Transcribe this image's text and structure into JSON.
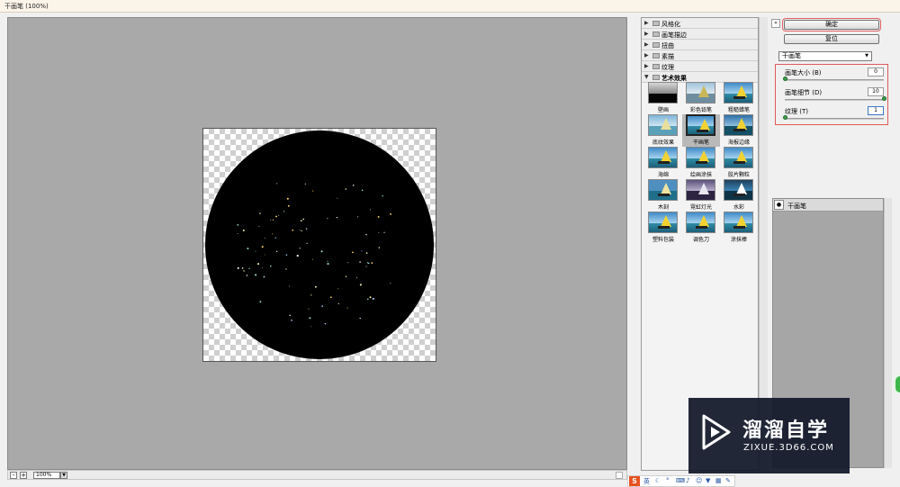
{
  "window": {
    "title": "干画笔 (100%)"
  },
  "preview": {
    "zoom": "100%",
    "zoom_minus": "-",
    "zoom_plus": "+"
  },
  "gallery": {
    "categories": [
      {
        "label": "风格化",
        "expanded": false
      },
      {
        "label": "画笔描边",
        "expanded": false
      },
      {
        "label": "扭曲",
        "expanded": false
      },
      {
        "label": "素描",
        "expanded": false
      },
      {
        "label": "纹理",
        "expanded": false
      },
      {
        "label": "艺术效果",
        "expanded": true
      }
    ],
    "filters": [
      {
        "label": "壁画"
      },
      {
        "label": "彩色铅笔"
      },
      {
        "label": "粗糙蜡笔"
      },
      {
        "label": "底纹效果"
      },
      {
        "label": "干画笔",
        "selected": true
      },
      {
        "label": "海报边缘"
      },
      {
        "label": "海绵"
      },
      {
        "label": "绘画涂抹"
      },
      {
        "label": "胶片颗粒"
      },
      {
        "label": "木刻"
      },
      {
        "label": "霓虹灯光"
      },
      {
        "label": "水彩"
      },
      {
        "label": "塑料包装"
      },
      {
        "label": "调色刀"
      },
      {
        "label": "涂抹棒"
      }
    ]
  },
  "controls": {
    "collapse_icon": "«",
    "ok_label": "确定",
    "reset_label": "复位",
    "filter_select": "干画笔",
    "params": [
      {
        "label": "画笔大小 (B)",
        "value": "0",
        "slider_fraction": 0.0
      },
      {
        "label": "画笔细节 (D)",
        "value": "10",
        "slider_fraction": 1.0
      },
      {
        "label": "纹理 (T)",
        "value": "1",
        "slider_fraction": 0.0
      }
    ]
  },
  "layers": [
    {
      "name": "干画笔",
      "visible": true
    }
  ],
  "watermark": {
    "title": "溜溜自学",
    "url": "ZIXUE.3D66.COM"
  },
  "ime": {
    "logo": "S",
    "mode": "英"
  },
  "colors": {
    "accent_red": "#e05a5a",
    "knob_green": "#3aa04a",
    "preview_bg": "#a9a9a9"
  }
}
